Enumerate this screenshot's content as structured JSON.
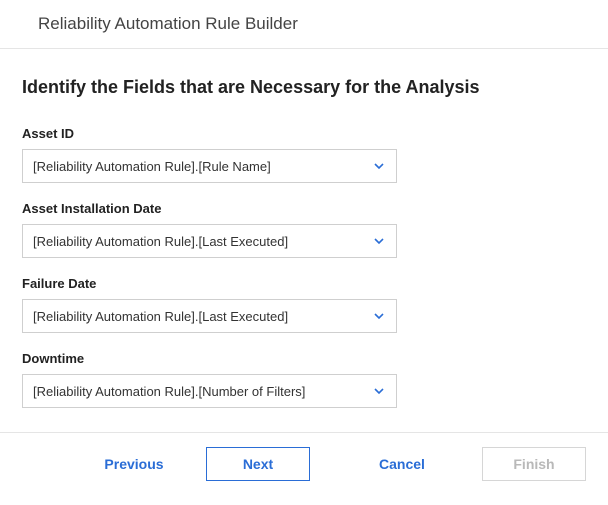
{
  "header": {
    "title": "Reliability Automation Rule Builder"
  },
  "step": {
    "title": "Identify the Fields that are Necessary for the Analysis"
  },
  "fields": [
    {
      "label": "Asset ID",
      "value": "[Reliability Automation Rule].[Rule Name]"
    },
    {
      "label": "Asset Installation Date",
      "value": "[Reliability Automation Rule].[Last Executed]"
    },
    {
      "label": "Failure Date",
      "value": "[Reliability Automation Rule].[Last Executed]"
    },
    {
      "label": "Downtime",
      "value": "[Reliability Automation Rule].[Number of Filters]"
    }
  ],
  "buttons": {
    "previous": "Previous",
    "next": "Next",
    "cancel": "Cancel",
    "finish": "Finish"
  },
  "colors": {
    "accent": "#2a6dd6"
  }
}
